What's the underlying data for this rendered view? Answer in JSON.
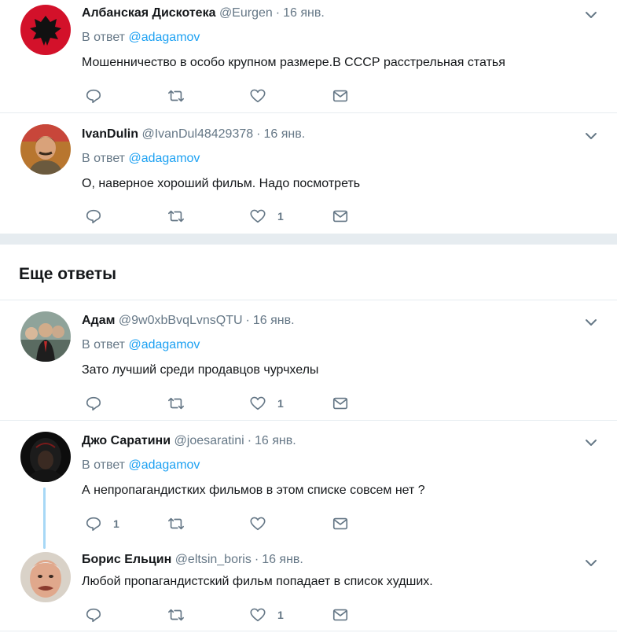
{
  "reply_prefix": "В ответ",
  "more_replies_title": "Еще ответы",
  "tweets": [
    {
      "name": "Албанская Дискотека",
      "handle": "@Eurgen",
      "time": "16 янв.",
      "reply_to": "@adagamov",
      "text": "Мошенничество в особо крупном размере.В СССР расстрельная статья",
      "replies": "",
      "retweets": "",
      "likes": ""
    },
    {
      "name": "IvanDulin",
      "handle": "@IvanDul48429378",
      "time": "16 янв.",
      "reply_to": "@adagamov",
      "text": "О, наверное хороший фильм. Надо посмотреть",
      "replies": "",
      "retweets": "",
      "likes": "1"
    },
    {
      "name": "Адам",
      "handle": "@9w0xbBvqLvnsQTU",
      "time": "16 янв.",
      "reply_to": "@adagamov",
      "text": "Зато лучший среди продавцов чурчхелы",
      "replies": "",
      "retweets": "",
      "likes": "1"
    },
    {
      "name": "Джо Саратини",
      "handle": "@joesaratini",
      "time": "16 янв.",
      "reply_to": "@adagamov",
      "text": "А непропагандистких фильмов в этом списке совсем нет ?",
      "replies": "1",
      "retweets": "",
      "likes": ""
    },
    {
      "name": "Борис Ельцин",
      "handle": "@eltsin_boris",
      "time": "16 янв.",
      "text": "Любой пропагандистский фильм попадает в список худших.",
      "replies": "",
      "retweets": "",
      "likes": "1"
    }
  ],
  "colors": {
    "accent": "#1da1f2",
    "secondary_text": "#657786",
    "divider": "#e6ecf0",
    "thread_line": "#a7d8f6"
  }
}
